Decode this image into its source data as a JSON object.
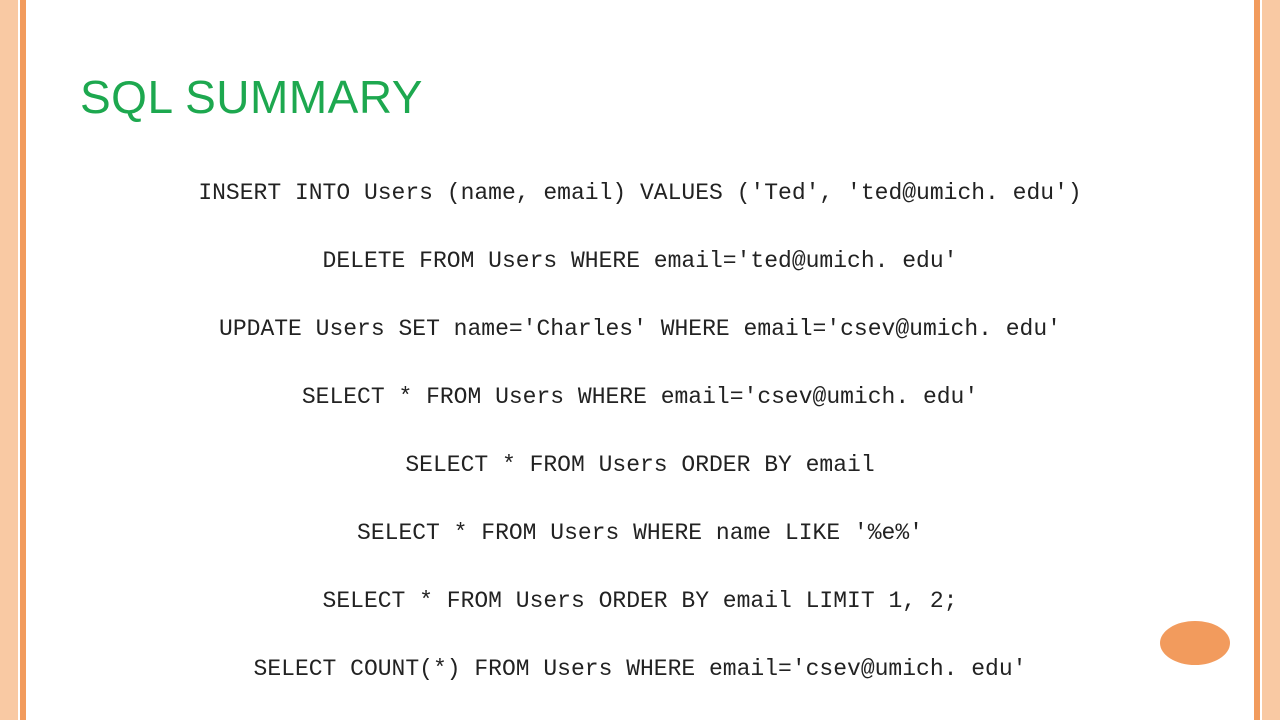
{
  "title": "SQL SUMMARY",
  "lines": [
    "INSERT INTO Users (name, email) VALUES ('Ted', 'ted@umich. edu')",
    "DELETE FROM Users WHERE email='ted@umich. edu'",
    "UPDATE Users SET name='Charles' WHERE email='csev@umich. edu'",
    "SELECT * FROM Users WHERE email='csev@umich. edu'",
    "SELECT * FROM Users ORDER BY email",
    "SELECT * FROM Users WHERE name LIKE '%e%'",
    "SELECT * FROM Users ORDER BY email LIMIT 1, 2;",
    "SELECT COUNT(*) FROM Users WHERE email='csev@umich. edu'"
  ]
}
